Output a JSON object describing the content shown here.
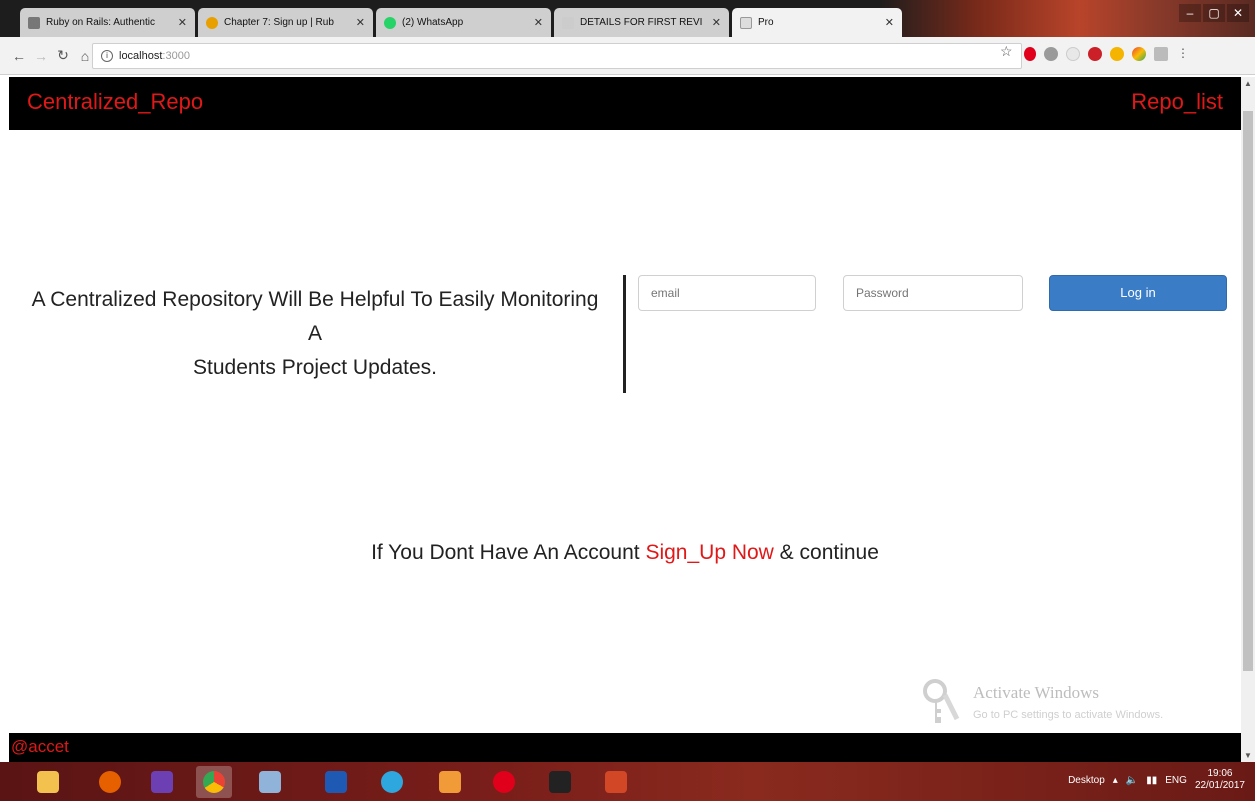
{
  "browser": {
    "tabs": [
      {
        "title": "Ruby on Rails: Authentic",
        "favicon_color": "#777"
      },
      {
        "title": "Chapter 7: Sign up | Rub",
        "favicon_color": "#e8a000"
      },
      {
        "title": "(2) WhatsApp",
        "favicon_color": "#25d366"
      },
      {
        "title": "DETAILS FOR FIRST REVI",
        "favicon_color": "#ccc"
      },
      {
        "title": "Pro",
        "favicon_color": "#ddd"
      }
    ],
    "address": {
      "host": "localhost",
      "port": ":3000"
    },
    "icons": [
      "back-icon",
      "forward-icon",
      "reload-icon",
      "home-icon",
      "star-icon",
      "opera-icon",
      "pinterest-icon"
    ]
  },
  "navbar": {
    "brand": "Centralized_Repo",
    "repo_list": "Repo_list"
  },
  "hero": {
    "line1": "A Centralized Repository Will Be Helpful To Easily Monitoring",
    "line2": "A",
    "line3": "Students Project Updates."
  },
  "login_form": {
    "email_placeholder": "email",
    "password_placeholder": "Password",
    "submit_label": "Log in"
  },
  "signup": {
    "prefix": "If You Dont Have An Account ",
    "link": "Sign_Up Now",
    "suffix": " & continue"
  },
  "watermark": {
    "title": "Activate Windows",
    "subtitle": "Go to PC settings to activate Windows."
  },
  "footer": {
    "tag": "@accet"
  },
  "taskbar": {
    "apps": [
      "file-explorer",
      "firefox",
      "visual-studio",
      "chrome",
      "notepad",
      "photoshop",
      "telegram",
      "sublime",
      "opera",
      "terminal",
      "powerpoint"
    ],
    "desktop_label": "Desktop",
    "lang": "ENG",
    "time": "19:06",
    "date": "22/01/2017"
  },
  "colors": {
    "accent_red": "#e01818",
    "button_blue": "#3a7cc6",
    "navbar_bg": "#000000"
  }
}
